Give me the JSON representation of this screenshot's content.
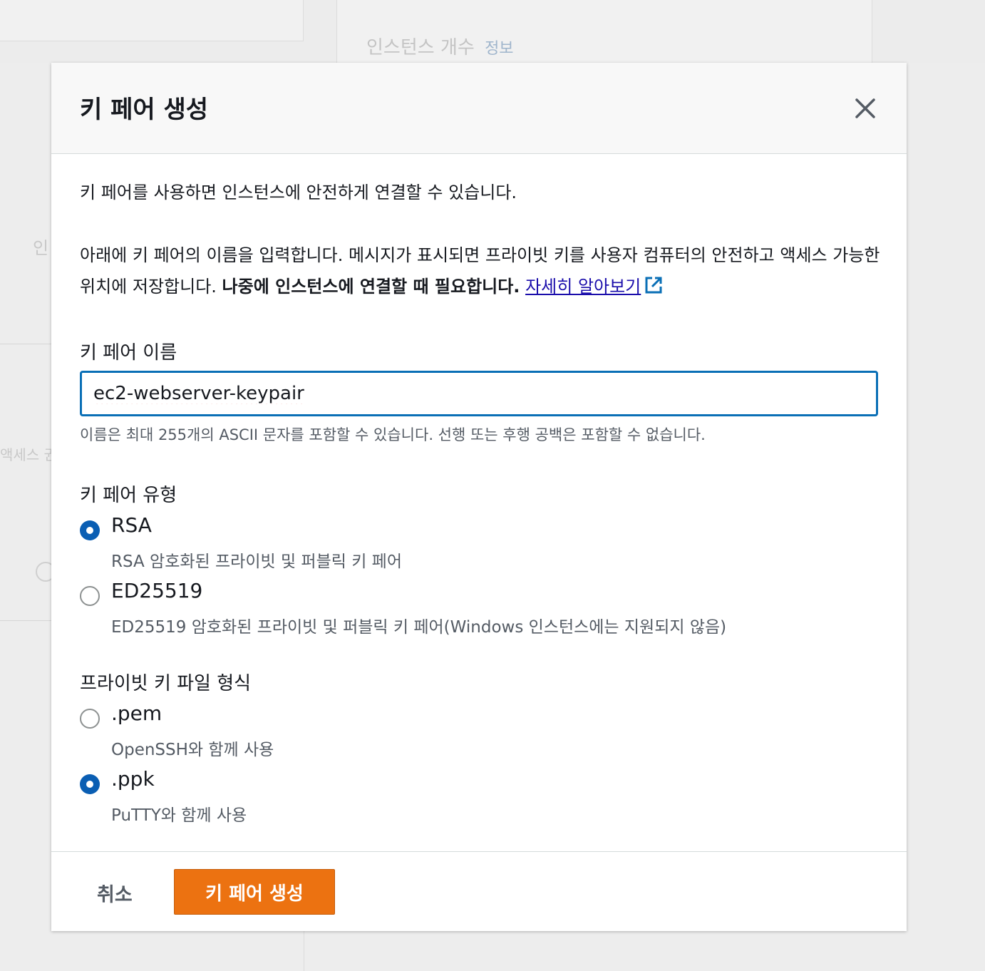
{
  "background": {
    "instance_count_label": "인스턴스 개수",
    "instance_count_info": "정보",
    "left_text_1": "인",
    "left_text_2": "액세스 권"
  },
  "modal": {
    "title": "키 페어 생성",
    "intro": "키 페어를 사용하면 인스턴스에 안전하게 연결할 수 있습니다.",
    "description": "아래에 키 페어의 이름을 입력합니다. 메시지가 표시되면 프라이빗 키를 사용자 컴퓨터의 안전하고 액세스 가능한 위치에 저장합니다. ",
    "description_bold": "나중에 인스턴스에 연결할 때 필요합니다.",
    "learn_more": "자세히 알아보기",
    "name_label": "키 페어 이름",
    "name_value": "ec2-webserver-keypair",
    "name_hint": "이름은 최대 255개의 ASCII 문자를 포함할 수 있습니다. 선행 또는 후행 공백은 포함할 수 없습니다.",
    "type_label": "키 페어 유형",
    "type_options": [
      {
        "title": "RSA",
        "desc": "RSA 암호화된 프라이빗 및 퍼블릭 키 페어",
        "checked": true
      },
      {
        "title": "ED25519",
        "desc": "ED25519 암호화된 프라이빗 및 퍼블릭 키 페어(Windows 인스턴스에는 지원되지 않음)",
        "checked": false
      }
    ],
    "format_label": "프라이빗 키 파일 형식",
    "format_options": [
      {
        "title": ".pem",
        "desc": "OpenSSH와 함께 사용",
        "checked": false
      },
      {
        "title": ".ppk",
        "desc": "PuTTY와 함께 사용",
        "checked": true
      }
    ],
    "cancel_label": "취소",
    "create_label": "키 페어 생성"
  },
  "colors": {
    "accent": "#ec7211",
    "focus": "#0a6fb6",
    "radio_checked": "#0a5eb3",
    "link": "#1a0dab"
  },
  "icons": [
    "close-icon",
    "external-link-icon"
  ]
}
